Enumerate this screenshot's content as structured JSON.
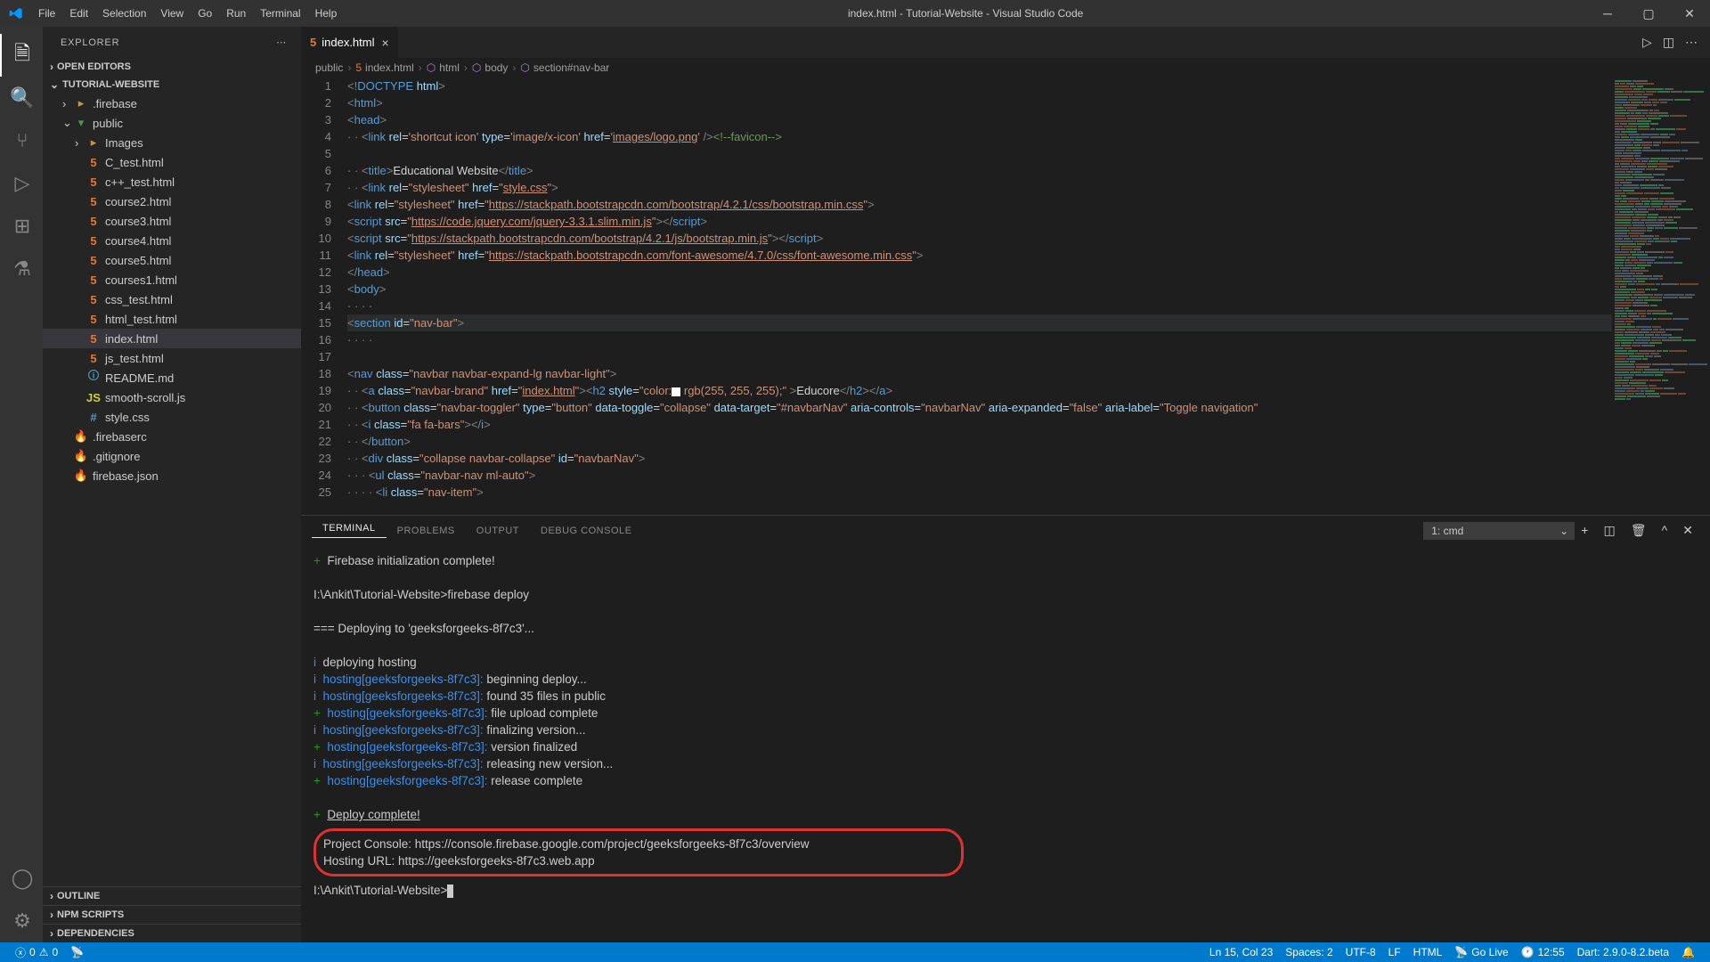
{
  "title": "index.html - Tutorial-Website - Visual Studio Code",
  "menu": [
    "File",
    "Edit",
    "Selection",
    "View",
    "Go",
    "Run",
    "Terminal",
    "Help"
  ],
  "sidebar": {
    "header": "EXPLORER",
    "sections": {
      "openEditors": "OPEN EDITORS",
      "folder": "TUTORIAL-WEBSITE",
      "outline": "OUTLINE",
      "npm": "NPM SCRIPTS",
      "deps": "DEPENDENCIES"
    },
    "tree": [
      {
        "name": ".firebase",
        "type": "folder",
        "indent": 1,
        "chev": "›"
      },
      {
        "name": "public",
        "type": "folder-open",
        "indent": 1,
        "chev": "⌄"
      },
      {
        "name": "Images",
        "type": "folder",
        "indent": 2,
        "chev": "›"
      },
      {
        "name": "C_test.html",
        "type": "html",
        "indent": 2
      },
      {
        "name": "c++_test.html",
        "type": "html",
        "indent": 2
      },
      {
        "name": "course2.html",
        "type": "html",
        "indent": 2
      },
      {
        "name": "course3.html",
        "type": "html",
        "indent": 2
      },
      {
        "name": "course4.html",
        "type": "html",
        "indent": 2
      },
      {
        "name": "course5.html",
        "type": "html",
        "indent": 2
      },
      {
        "name": "courses1.html",
        "type": "html",
        "indent": 2
      },
      {
        "name": "css_test.html",
        "type": "html",
        "indent": 2
      },
      {
        "name": "html_test.html",
        "type": "html",
        "indent": 2
      },
      {
        "name": "index.html",
        "type": "html",
        "indent": 2,
        "selected": true
      },
      {
        "name": "js_test.html",
        "type": "html",
        "indent": 2
      },
      {
        "name": "README.md",
        "type": "md",
        "indent": 2
      },
      {
        "name": "smooth-scroll.js",
        "type": "js",
        "indent": 2
      },
      {
        "name": "style.css",
        "type": "css",
        "indent": 2
      },
      {
        "name": ".firebaserc",
        "type": "fire",
        "indent": 1
      },
      {
        "name": ".gitignore",
        "type": "fire",
        "indent": 1
      },
      {
        "name": "firebase.json",
        "type": "fire",
        "indent": 1
      }
    ]
  },
  "tab": {
    "label": "index.html"
  },
  "breadcrumbs": [
    "public",
    "index.html",
    "html",
    "body",
    "section#nav-bar"
  ],
  "panel": {
    "tabs": [
      "TERMINAL",
      "PROBLEMS",
      "OUTPUT",
      "DEBUG CONSOLE"
    ],
    "select": "1: cmd"
  },
  "terminal": {
    "l1": "Firebase initialization complete!",
    "l2": "I:\\Ankit\\Tutorial-Website>firebase deploy",
    "l3": "=== Deploying to 'geeksforgeeks-8f7c3'...",
    "l4": "deploying hosting",
    "h": "hosting[geeksforgeeks-8f7c3]:",
    "m5": "beginning deploy...",
    "m6": "found 35 files in public",
    "m7": "file upload complete",
    "m8": "finalizing version...",
    "m9": "version finalized",
    "m10": "releasing new version...",
    "m11": "release complete",
    "l12": "Deploy complete!",
    "pc": "Project Console: https://console.firebase.google.com/project/geeksforgeeks-8f7c3/overview",
    "hu": "Hosting URL: https://geeksforgeeks-8f7c3.web.app",
    "prompt": "I:\\Ankit\\Tutorial-Website>"
  },
  "status": {
    "errors": "0",
    "warnings": "0",
    "lncol": "Ln 15, Col 23",
    "spaces": "Spaces: 2",
    "enc": "UTF-8",
    "eol": "LF",
    "lang": "HTML",
    "golive": "Go Live",
    "clock": "12:55",
    "dart": "Dart: 2.9.0-8.2.beta"
  }
}
